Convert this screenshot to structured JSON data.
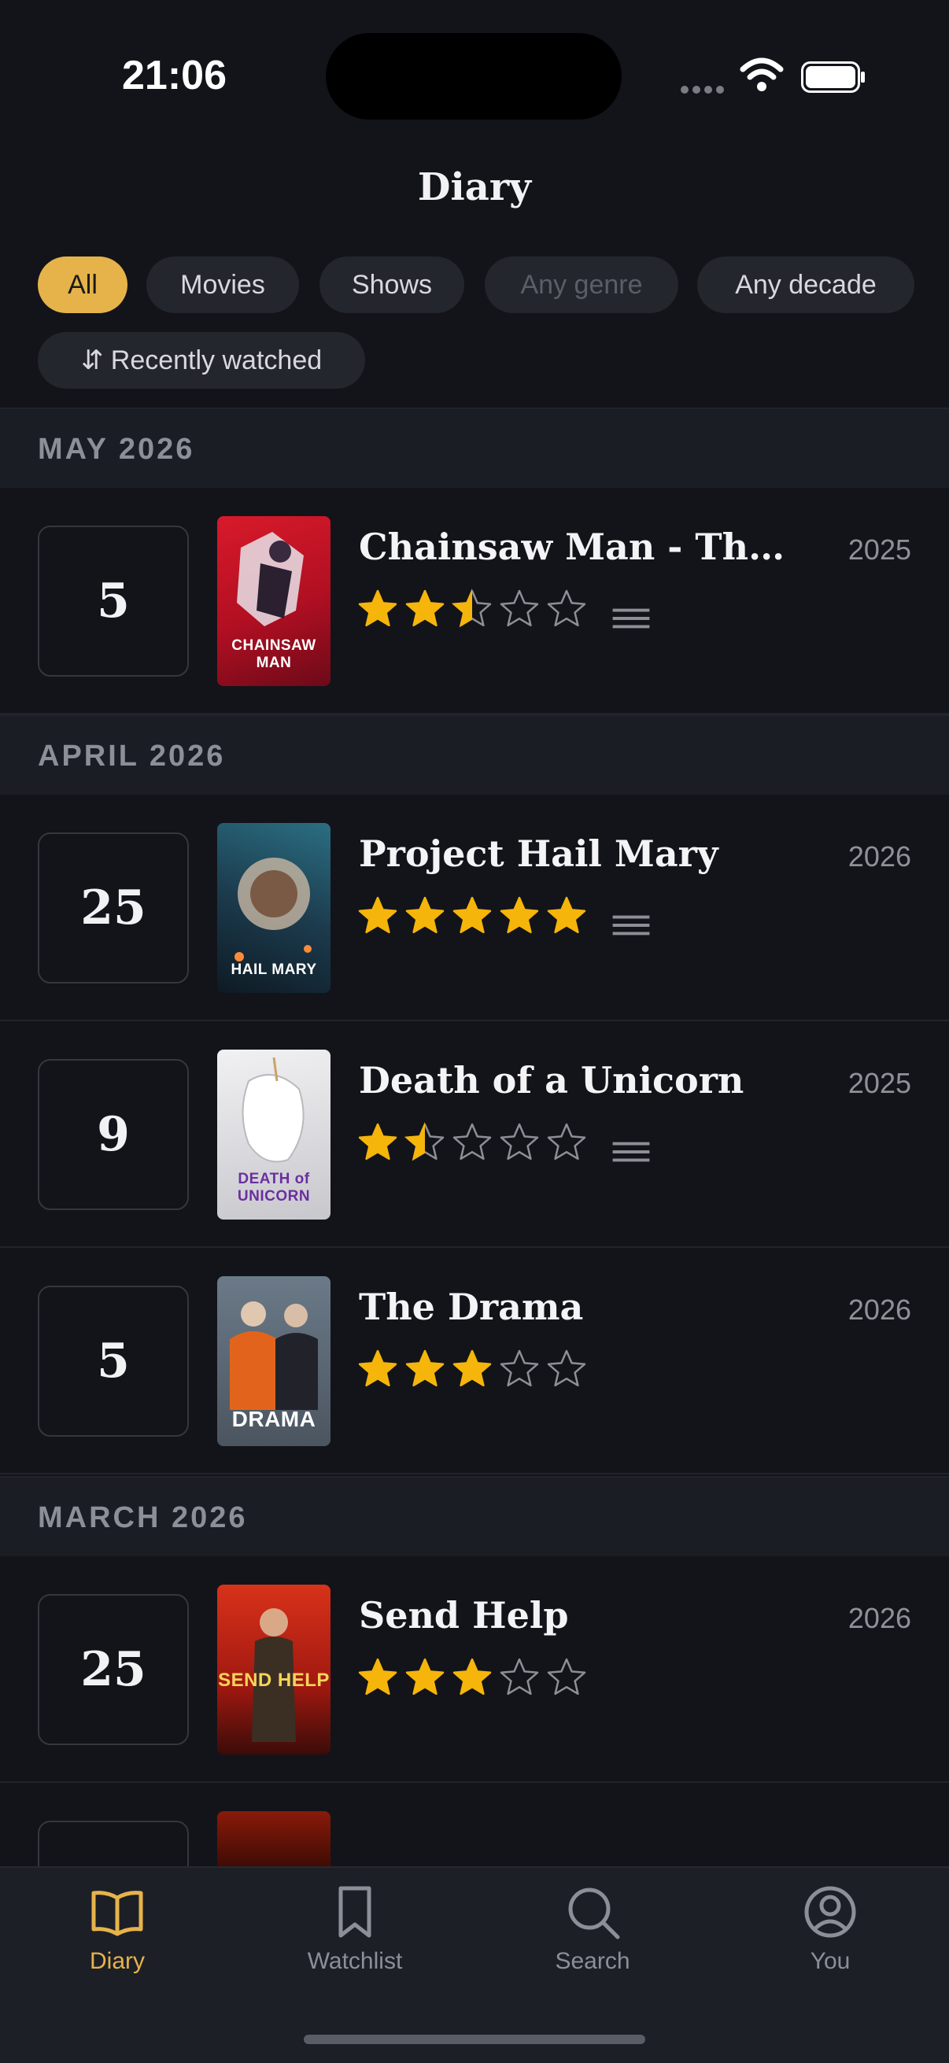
{
  "status": {
    "time": "21:06"
  },
  "page": {
    "title": "Diary"
  },
  "filters": {
    "all": "All",
    "movies": "Movies",
    "shows": "Shows",
    "genre": "Any genre",
    "decade": "Any decade",
    "sort": "⇵ Recently watched"
  },
  "sections": [
    {
      "month": "MAY 2026"
    },
    {
      "month": "APRIL 2026"
    },
    {
      "month": "MARCH 2026"
    }
  ],
  "entries": [
    {
      "day": "5",
      "title": "Chainsaw Man - The Movie: Reze Arc",
      "year": "2025",
      "rating": 2.5,
      "has_review": true,
      "poster_text": "CHAINSAW MAN"
    },
    {
      "day": "25",
      "title": "Project Hail Mary",
      "year": "2026",
      "rating": 5,
      "has_review": true,
      "poster_text": "HAIL MARY"
    },
    {
      "day": "9",
      "title": "Death of a Unicorn",
      "year": "2025",
      "rating": 1.5,
      "has_review": true,
      "poster_text": "DEATH of UNICORN"
    },
    {
      "day": "5",
      "title": "The Drama",
      "year": "2026",
      "rating": 3,
      "has_review": false,
      "poster_text": "DRAMA"
    },
    {
      "day": "25",
      "title": "Send Help",
      "year": "2026",
      "rating": 3,
      "has_review": false,
      "poster_text": "SEND HELP"
    }
  ],
  "tabs": {
    "diary": "Diary",
    "watchlist": "Watchlist",
    "search": "Search",
    "you": "You"
  },
  "colors": {
    "accent": "#e6b34b",
    "star": "#f5b50a",
    "background": "#13141a"
  }
}
